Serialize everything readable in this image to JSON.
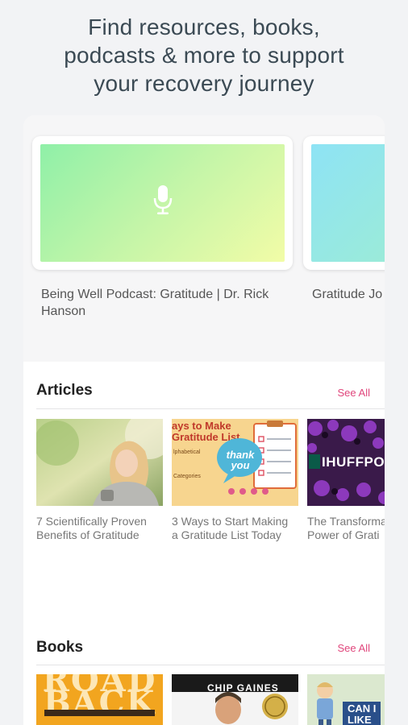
{
  "headline": {
    "line1": "Find resources, books,",
    "line2": "podcasts & more to support",
    "line3": "your recovery journey"
  },
  "podcasts": [
    {
      "title_line1": "Being Well Podcast: Gratitude | Dr. Rick",
      "title_line2": "Hanson",
      "icon": "microphone-icon"
    },
    {
      "title_line1": "Gratitude Jo",
      "title_line2": "",
      "icon": ""
    }
  ],
  "articles": {
    "title": "Articles",
    "see_all": "See All",
    "items": [
      {
        "caption_line1": "7 Scientifically Proven",
        "caption_line2": "Benefits of Gratitude"
      },
      {
        "caption_line1": "3 Ways to Start Making",
        "caption_line2": "a Gratitude List Today",
        "image_text": {
          "heading1": "ays to Make",
          "heading2": "Gratitude List",
          "bubble": "thank you",
          "label1": "lphabetical",
          "label2": "Categories"
        }
      },
      {
        "caption_line1": "The Transforma",
        "caption_line2": "Power of Grati",
        "image_text": {
          "logo": "IHUFFPO"
        }
      }
    ]
  },
  "books": {
    "title": "Books",
    "see_all": "See All",
    "items": [
      {
        "cover_text1": "ROAD",
        "cover_text2": "BACK"
      },
      {
        "cover_text1": "CHIP GAINES",
        "cover_text2": ""
      },
      {
        "cover_text1": "CAN I",
        "cover_text2": "LIKE"
      }
    ]
  },
  "colors": {
    "accent": "#e0467c",
    "podcast_gradient_start": "#93f1a6",
    "podcast_gradient_end": "#f0fca6"
  }
}
